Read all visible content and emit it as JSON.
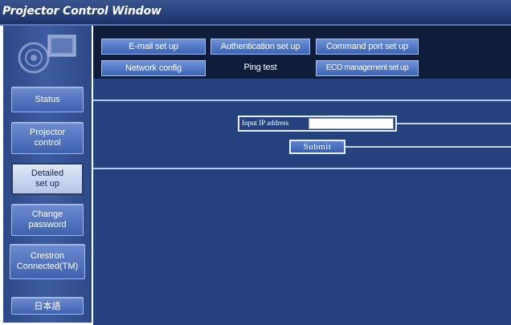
{
  "window": {
    "title": "Projector Control Window"
  },
  "sidebar": {
    "items": [
      {
        "label_lines": [
          "Status"
        ]
      },
      {
        "label_lines": [
          "Projector",
          "control"
        ]
      },
      {
        "label_lines": [
          "Detailed",
          "set up"
        ],
        "active": true
      },
      {
        "label_lines": [
          "Change",
          "password"
        ]
      },
      {
        "label_lines": [
          "Crestron",
          "Connected(TM)"
        ]
      },
      {
        "label_lines": [
          "日本語"
        ]
      }
    ]
  },
  "tabs": {
    "row1": [
      "E-mail set up",
      "Authentication set up",
      "Command port set up"
    ],
    "row2": [
      "Network config",
      "Ping test",
      "ECO management set up"
    ],
    "active": "Ping test"
  },
  "form": {
    "ip_label": "Input IP address",
    "ip_value": "",
    "submit_label": "Submit"
  },
  "colors": {
    "titlebar": "#1c3268",
    "sidebar": "#2c4987",
    "content_bg": "#24437e",
    "tab_strip": "#0f1d3a",
    "button": "#3f62ad"
  }
}
